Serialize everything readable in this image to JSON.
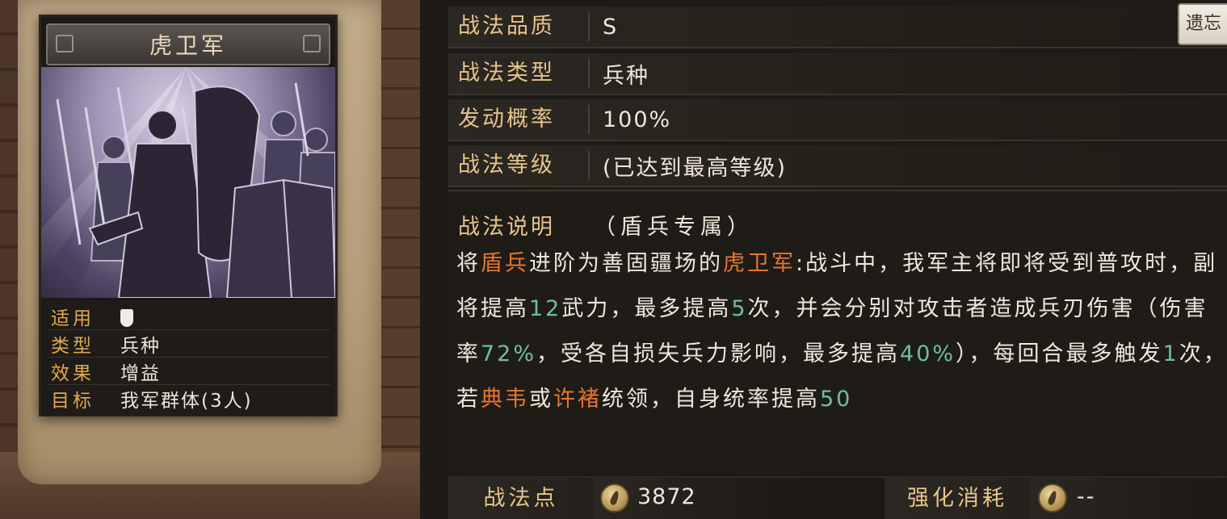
{
  "card": {
    "title": "虎卫军",
    "info": [
      {
        "label": "适用",
        "value": "",
        "icon": "shield-icon"
      },
      {
        "label": "类型",
        "value": "兵种"
      },
      {
        "label": "效果",
        "value": "增益"
      },
      {
        "label": "目标",
        "value": "我军群体(3人)"
      }
    ]
  },
  "stamp_button": {
    "label": "遗忘"
  },
  "details": {
    "quality": {
      "label": "战法品质",
      "value": "S"
    },
    "type": {
      "label": "战法类型",
      "value": "兵种"
    },
    "rate": {
      "label": "发动概率",
      "value": "100%"
    },
    "level": {
      "label": "战法等级",
      "value": "(已达到最高等级)"
    }
  },
  "description": {
    "label": "战法说明",
    "sub": "（盾兵专属）",
    "segments": [
      {
        "t": "将",
        "c": ""
      },
      {
        "t": "盾兵",
        "c": "orange"
      },
      {
        "t": "进阶为善固疆场的",
        "c": ""
      },
      {
        "t": "虎卫军",
        "c": "orange"
      },
      {
        "t": ":战斗中，我军主将即将受到普攻时，副将提高",
        "c": ""
      },
      {
        "t": "12",
        "c": "green"
      },
      {
        "t": "武力，最多提高",
        "c": ""
      },
      {
        "t": "5",
        "c": "green"
      },
      {
        "t": "次，并会分别对攻击者造成兵刃伤害（伤害率",
        "c": ""
      },
      {
        "t": "72%",
        "c": "green"
      },
      {
        "t": "，受各自损失兵力影响，最多提高",
        "c": ""
      },
      {
        "t": "40%",
        "c": "green"
      },
      {
        "t": "），每回合最多触发",
        "c": ""
      },
      {
        "t": "1",
        "c": "green"
      },
      {
        "t": "次，若",
        "c": ""
      },
      {
        "t": "典韦",
        "c": "orange"
      },
      {
        "t": "或",
        "c": ""
      },
      {
        "t": "许褚",
        "c": "orange"
      },
      {
        "t": "统领，自身统率提高",
        "c": ""
      },
      {
        "t": "50",
        "c": "green"
      }
    ]
  },
  "footer": {
    "points_label": "战法点",
    "points_value": "3872",
    "cost_label": "强化消耗",
    "cost_value": "--"
  },
  "colors": {
    "gold_label": "#e6c48b",
    "orange_highlight": "#e5762f",
    "green_highlight": "#6fbf9a"
  }
}
